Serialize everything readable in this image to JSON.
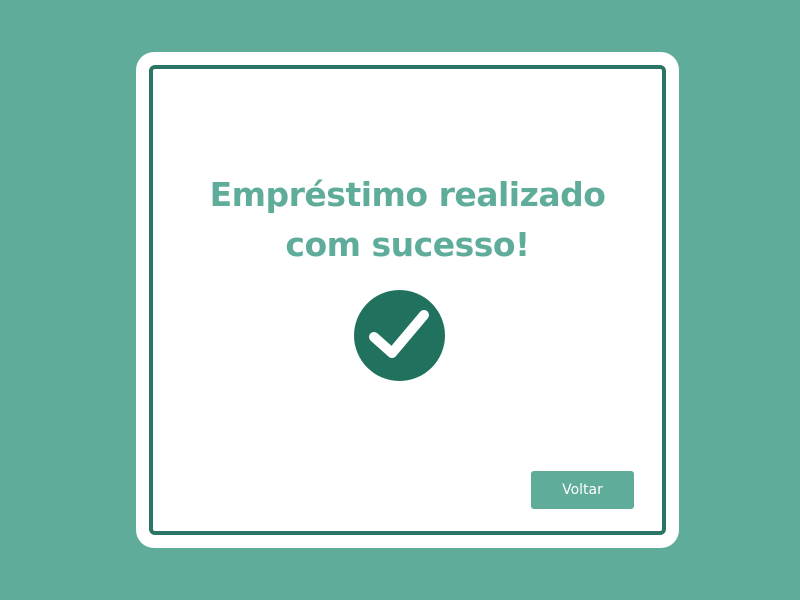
{
  "dialog": {
    "title_line1": "Empréstimo realizado",
    "title_line2": "com sucesso!",
    "status_icon": "check-circle-icon",
    "back_button_label": "Voltar"
  },
  "colors": {
    "background": "#5fac9a",
    "card": "#ffffff",
    "frame_border": "#2a7565",
    "title_text": "#5fac9a",
    "check_circle": "#20725f",
    "button": "#5fac9a",
    "button_text": "#ffffff"
  }
}
